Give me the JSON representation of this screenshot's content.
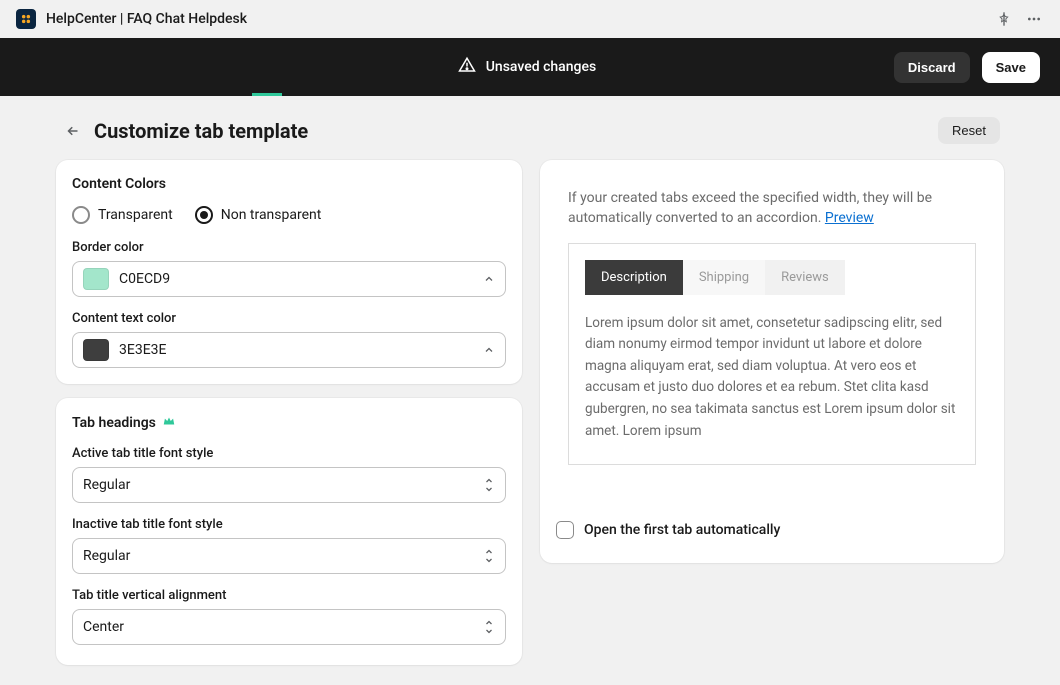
{
  "app": {
    "title": "HelpCenter | FAQ Chat Helpdesk"
  },
  "banner": {
    "message": "Unsaved changes",
    "discard_label": "Discard",
    "save_label": "Save"
  },
  "page": {
    "title": "Customize tab template",
    "reset_label": "Reset"
  },
  "content_colors": {
    "section_title": "Content Colors",
    "radio_transparent": "Transparent",
    "radio_non_transparent": "Non transparent",
    "selected": "non_transparent",
    "border_color": {
      "label": "Border color",
      "value": "C0ECD9",
      "hex": "#a3e6cb"
    },
    "text_color": {
      "label": "Content text color",
      "value": "3E3E3E",
      "hex": "#3e3e3e"
    }
  },
  "tab_headings": {
    "section_title": "Tab headings",
    "active_style": {
      "label": "Active tab title font style",
      "value": "Regular"
    },
    "inactive_style": {
      "label": "Inactive tab title font style",
      "value": "Regular"
    },
    "vertical_align": {
      "label": "Tab title vertical alignment",
      "value": "Center"
    }
  },
  "preview": {
    "hint_text": "If your created tabs exceed the specified width, they will be automatically converted to an accordion. ",
    "preview_link": "Preview",
    "tabs": [
      {
        "label": "Description",
        "active": true
      },
      {
        "label": "Shipping",
        "active": false
      },
      {
        "label": "Reviews",
        "active": false
      }
    ],
    "body": "Lorem ipsum dolor sit amet, consetetur sadipscing elitr, sed diam nonumy eirmod tempor invidunt ut labore et dolore magna aliquyam erat, sed diam voluptua. At vero eos et accusam et justo duo dolores et ea rebum. Stet clita kasd gubergren, no sea takimata sanctus est Lorem ipsum dolor sit amet. Lorem ipsum",
    "checkbox_label": "Open the first tab automatically"
  }
}
